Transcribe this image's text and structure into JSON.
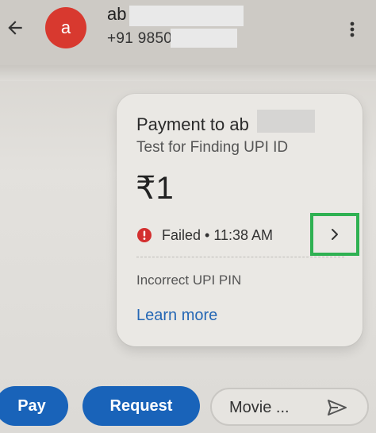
{
  "header": {
    "contact_initial": "a",
    "contact_name": "ab",
    "contact_phone": "+91 9850",
    "back_icon": "arrow-left-icon",
    "menu_icon": "more-vert-icon"
  },
  "payment_card": {
    "title": "Payment to ab",
    "note": "Test for Finding UPI ID",
    "amount": "₹1",
    "status": "Failed • 11:38 AM",
    "status_icon": "error-icon",
    "status_color": "#d32f2f",
    "reason": "Incorrect UPI PIN",
    "learn_more": "Learn more",
    "details_icon": "chevron-right-icon",
    "highlight_color": "#2fb152"
  },
  "bottom_bar": {
    "pay_label": "Pay",
    "request_label": "Request",
    "message_value": "Movie ...",
    "send_icon": "send-icon",
    "accent": "#1963b9"
  },
  "colors": {
    "avatar": "#d8392f",
    "link": "#2668b5"
  }
}
